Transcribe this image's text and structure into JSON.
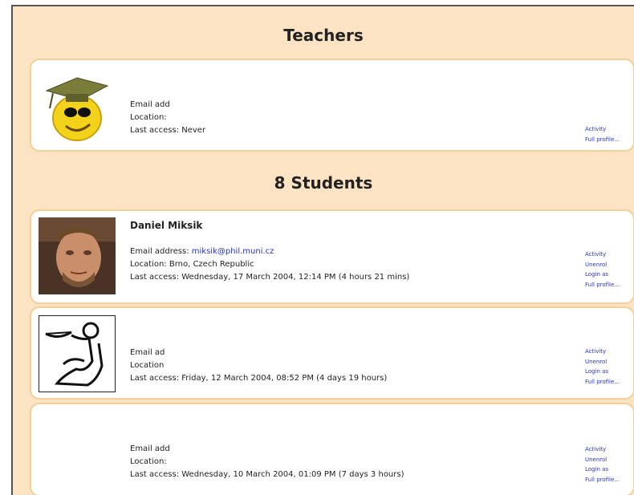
{
  "teachers": {
    "heading": "Teachers",
    "items": [
      {
        "email": "Email add",
        "location": "Location:",
        "last_access": "Last access: Never",
        "links": [
          "Activity",
          "Full profile..."
        ]
      }
    ]
  },
  "students": {
    "heading": "8 Students",
    "items": [
      {
        "name": "Daniel Miksik",
        "email_label": "Email address: ",
        "email_link": "miksik@phil.muni.cz",
        "location": "Location: Brno, Czech Republic",
        "last_access": "Last access: Wednesday, 17 March 2004, 12:14 PM  (4 hours 21 mins)",
        "links": [
          "Activity",
          "Unenrol",
          "Login as",
          "Full profile..."
        ]
      },
      {
        "email": "Email ad",
        "location": "Location",
        "last_access": "Last access: Friday, 12 March 2004, 08:52 PM  (4 days 19 hours)",
        "links": [
          "Activity",
          "Unenrol",
          "Login as",
          "Full profile..."
        ]
      },
      {
        "email": "Email add",
        "location": "Location:",
        "last_access": "Last access: Wednesday, 10 March 2004, 01:09 PM  (7 days 3 hours)",
        "links": [
          "Activity",
          "Unenrol",
          "Login as",
          "Full profile..."
        ]
      }
    ]
  }
}
